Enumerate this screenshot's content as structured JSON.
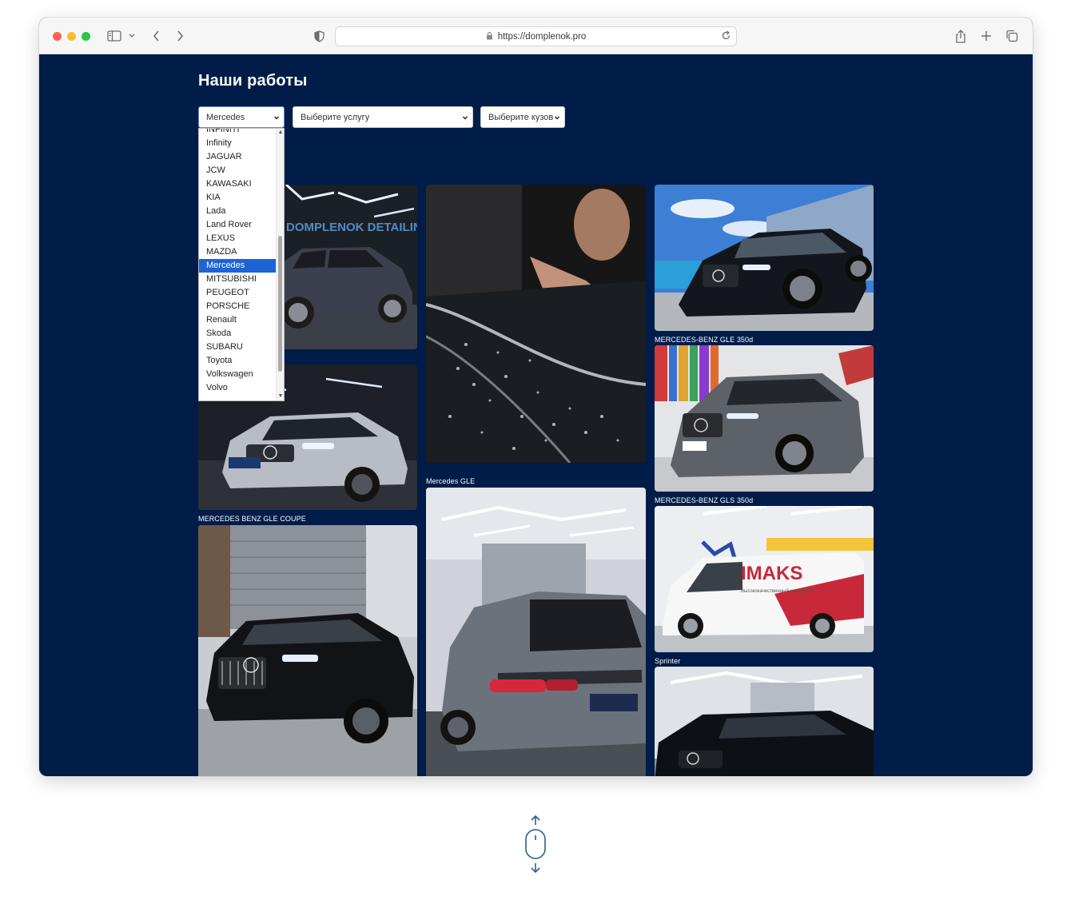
{
  "browser": {
    "url": "https://domplenok.pro"
  },
  "page": {
    "title": "Наши работы"
  },
  "filters": {
    "brand_selected": "Mercedes",
    "service_placeholder": "Выберите услугу",
    "body_placeholder": "Выберите кузов"
  },
  "brand_options": [
    "INFINITI",
    "Infinity",
    "JAGUAR",
    "JCW",
    "KAWASAKI",
    "KIA",
    "Lada",
    "Land Rover",
    "LEXUS",
    "MAZDA",
    "Mercedes",
    "MITSUBISHI",
    "PEUGEOT",
    "PORSCHE",
    "Renault",
    "Skoda",
    "SUBARU",
    "Toyota",
    "Volkswagen",
    "Volvo"
  ],
  "gallery": {
    "captions": {
      "c1": "MERCEDES BENZ GLE COUPE",
      "c2": "Mercedes GLE",
      "c3": "MERCEDES-BENZ GLE 350d",
      "c4": "MERCEDES-BENZ GLS 350d",
      "c5": "Sprinter"
    }
  },
  "photo_text": {
    "studio_sign": "DOMPLENOK DETAILING",
    "van_brand": "IMAKS",
    "van_tagline": "Высококачественный инструмент"
  },
  "colors": {
    "page_background": "#001c48",
    "selected_option": "#1e63d6",
    "scroll_hint": "#2a5e8c"
  }
}
